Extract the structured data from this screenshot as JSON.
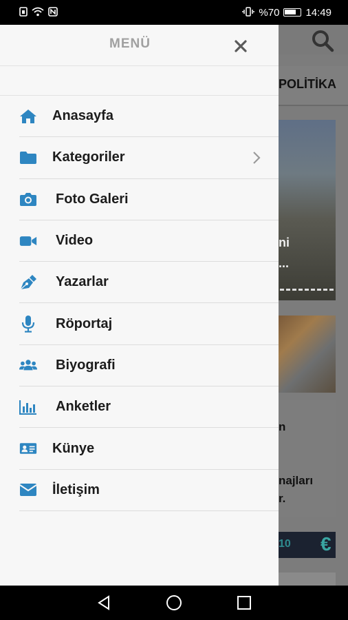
{
  "status_bar": {
    "battery_percent": "%70",
    "time": "14:49"
  },
  "background": {
    "tab_label": "POLİTİKA",
    "card1_line1": "ni",
    "card1_line2": "...",
    "text_n": "n",
    "text_majlari": "najları",
    "text_dot": "r.",
    "currency_value": "10"
  },
  "drawer": {
    "title": "MENÜ",
    "items": [
      {
        "label": "Anasayfa",
        "icon": "home-icon"
      },
      {
        "label": "Kategoriler",
        "icon": "folder-icon"
      },
      {
        "label": "Foto Galeri",
        "icon": "camera-icon"
      },
      {
        "label": "Video",
        "icon": "video-camera-icon"
      },
      {
        "label": "Yazarlar",
        "icon": "pen-icon"
      },
      {
        "label": "Röportaj",
        "icon": "microphone-icon"
      },
      {
        "label": "Biyografi",
        "icon": "users-icon"
      },
      {
        "label": "Anketler",
        "icon": "bar-chart-icon"
      },
      {
        "label": "Künye",
        "icon": "id-card-icon"
      },
      {
        "label": "İletişim",
        "icon": "envelope-icon"
      }
    ]
  },
  "colors": {
    "accent": "#2e86c1",
    "drawer_bg": "#f7f7f7",
    "label": "#1c1c1c",
    "title": "#a0a0a0"
  }
}
